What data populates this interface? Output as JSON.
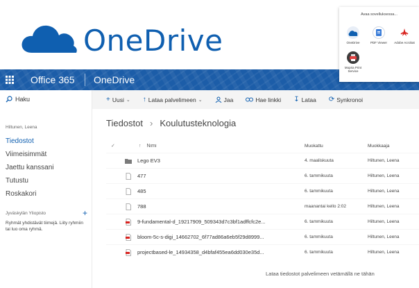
{
  "logo": {
    "text": "OneDrive",
    "color": "#0f5fb0"
  },
  "popup": {
    "title": "Avaa sovelluksessa...",
    "apps": [
      {
        "label": "OneDrive",
        "icon": "onedrive-cloud-icon"
      },
      {
        "label": "PDF Viewer",
        "icon": "pdf-viewer-icon"
      },
      {
        "label": "Adobe Acrobat",
        "icon": "adobe-acrobat-icon"
      },
      {
        "label": "Mopria Print Service",
        "icon": "mopria-print-icon"
      }
    ]
  },
  "suitebar": {
    "title": "Office 365",
    "app": "OneDrive",
    "color": "#1c5da8"
  },
  "sidebar": {
    "search_label": "Haku",
    "user": "Hiltunen, Leena",
    "items": [
      {
        "label": "Tiedostot",
        "active": true
      },
      {
        "label": "Viimeisimmät",
        "active": false
      },
      {
        "label": "Jaettu kanssani",
        "active": false
      },
      {
        "label": "Tutustu",
        "active": false
      },
      {
        "label": "Roskakori",
        "active": false
      }
    ],
    "group_title": "Jyväskylän Yliopisto",
    "group_note": "Ryhmät yhdistävät tiimejä. Liity ryhmiin tai luo oma ryhmä."
  },
  "commands": {
    "new": "Uusi",
    "upload": "Lataa palvelimeen",
    "share": "Jaa",
    "get_link": "Hae linkki",
    "download": "Lataa",
    "sync": "Synkronoi"
  },
  "breadcrumb": {
    "root": "Tiedostot",
    "current": "Koulutusteknologia"
  },
  "table": {
    "headers": {
      "name": "Nimi",
      "modified": "Muokattu",
      "modified_by": "Muokkaaja"
    },
    "rows": [
      {
        "type": "folder",
        "name": "Lego EV3",
        "modified": "4. maaliskuuta",
        "by": "Hiltunen, Leena"
      },
      {
        "type": "file",
        "name": "477",
        "modified": "6. tammikuuta",
        "by": "Hiltunen, Leena"
      },
      {
        "type": "file",
        "name": "485",
        "modified": "6. tammikuuta",
        "by": "Hiltunen, Leena"
      },
      {
        "type": "file",
        "name": "788",
        "modified": "maanantai kello 2:02",
        "by": "Hiltunen, Leena"
      },
      {
        "type": "pdf",
        "name": "9-fundamental-d_19217909_509343d7c3bf1adffcfc2e...",
        "modified": "6. tammikuuta",
        "by": "Hiltunen, Leena"
      },
      {
        "type": "pdf",
        "name": "bloom-5c-s-digi_14662702_6f77ad86a6eb5f29d8999...",
        "modified": "6. tammikuuta",
        "by": "Hiltunen, Leena"
      },
      {
        "type": "pdf",
        "name": "projectbased-le_14934358_d4bfaf455ea6dd030e35d...",
        "modified": "6. tammikuuta",
        "by": "Hiltunen, Leena"
      }
    ]
  },
  "drop_hint": "Lataa tiedostot palvelimeen vetämällä ne tähän"
}
